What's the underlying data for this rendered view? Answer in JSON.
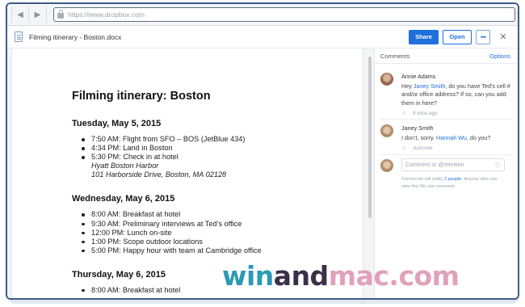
{
  "browser": {
    "url": "https://www.dropbox.com"
  },
  "header": {
    "doc_title": "Filming itinerary - Boston.docx",
    "share_label": "Share",
    "open_label": "Open",
    "more_label": "•••",
    "close_label": "✕"
  },
  "document": {
    "title": "Filming itinerary: Boston",
    "sections": [
      {
        "heading": "Tuesday, May 5, 2015",
        "items": [
          "7:50 AM: Flight from SFO – BOS (JetBlue 434)",
          "4:34 PM: Land in Boston",
          "5:30 PM: Check in at hotel"
        ],
        "sub_items": [
          "Hyatt Boston Harbor",
          "101 Harborside Drive, Boston, MA 02128"
        ]
      },
      {
        "heading": "Wednesday, May 6, 2015",
        "items": [
          "8:00 AM: Breakfast at hotel",
          "9:30 AM: Preliminary interviews at Ted’s office",
          "12:00 PM: Lunch on-site",
          "1:00 PM: Scope outdoor locations",
          "5:00 PM: Happy hour with team at Cambridge office"
        ]
      },
      {
        "heading": "Thursday, May 6, 2015",
        "items": [
          "8:00 AM: Breakfast at hotel"
        ]
      }
    ]
  },
  "comments": {
    "title": "Comments",
    "options_label": "Options",
    "list": [
      {
        "author": "Annie Adams",
        "text_before": "Hey ",
        "mention": "Janey Smith",
        "text_after": ", do you have Ted’s cell # and/or office address? If so, can you add them in here?",
        "time": "8 mins ago"
      },
      {
        "author": "Janey Smith",
        "text_before": "I don’t, sorry. ",
        "mention": "Hannah Wu",
        "text_after": ", do you?",
        "time": "Just now"
      }
    ],
    "compose_placeholder": "Comment or @mention",
    "compose_note_before": "Comments will notify ",
    "compose_note_link": "2 people",
    "compose_note_after": ". Anyone who can view this file can comment.",
    "separator": "·"
  },
  "watermark": {
    "part1": "win",
    "part2": "and",
    "part3": "mac.com"
  },
  "colors": {
    "accent": "#1f6fdc",
    "frame": "#3c5a8a"
  },
  "icons": [
    "back-icon",
    "forward-icon",
    "lock-icon",
    "document-icon",
    "star-icon",
    "add-person-icon",
    "close-icon"
  ]
}
